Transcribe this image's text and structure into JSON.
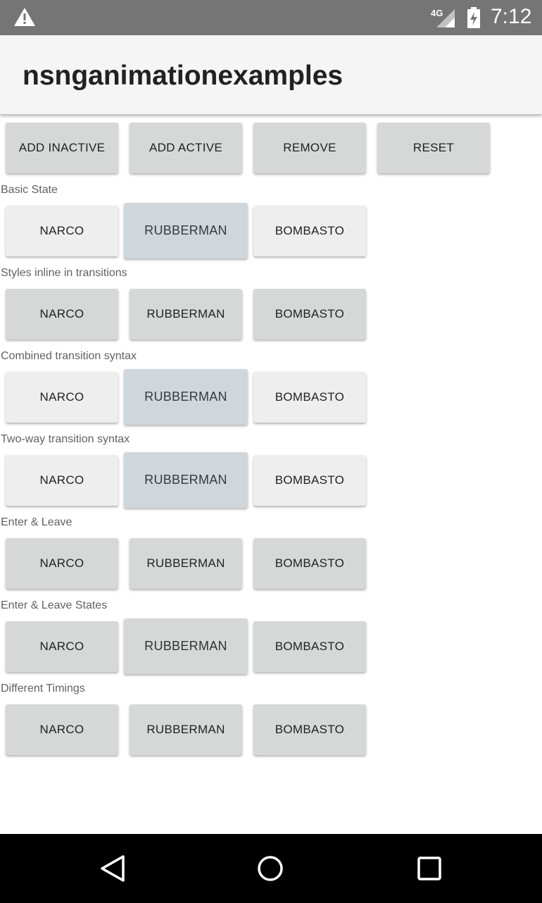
{
  "status_bar": {
    "network": "4G",
    "time": "7:12",
    "icons": [
      "warning-icon",
      "signal-icon",
      "battery-charging-icon"
    ]
  },
  "app_bar": {
    "title": "nsnganimationexamples"
  },
  "controls": {
    "add_inactive": "ADD INACTIVE",
    "add_active": "ADD ACTIVE",
    "remove": "REMOVE",
    "reset": "RESET"
  },
  "sections": [
    {
      "label": "Basic State",
      "buttons": [
        "NARCO",
        "RUBBERMAN",
        "BOMBASTO"
      ]
    },
    {
      "label": "Styles inline in transitions",
      "buttons": [
        "NARCO",
        "RUBBERMAN",
        "BOMBASTO"
      ]
    },
    {
      "label": "Combined transition syntax",
      "buttons": [
        "NARCO",
        "RUBBERMAN",
        "BOMBASTO"
      ]
    },
    {
      "label": "Two-way transition syntax",
      "buttons": [
        "NARCO",
        "RUBBERMAN",
        "BOMBASTO"
      ]
    },
    {
      "label": "Enter & Leave",
      "buttons": [
        "NARCO",
        "RUBBERMAN",
        "BOMBASTO"
      ]
    },
    {
      "label": "Enter & Leave States",
      "buttons": [
        "NARCO",
        "RUBBERMAN",
        "BOMBASTO"
      ]
    },
    {
      "label": "Different Timings",
      "buttons": [
        "NARCO",
        "RUBBERMAN",
        "BOMBASTO"
      ]
    }
  ],
  "nav_bar": {
    "icons": [
      "back-icon",
      "home-icon",
      "recents-icon"
    ]
  },
  "colors": {
    "status_bar": "#757575",
    "app_bar": "#f5f5f5",
    "button_default": "#d6d7d7",
    "button_inactive": "#eeeeee",
    "button_active": "#d0d7dc",
    "nav_bar": "#000000"
  }
}
